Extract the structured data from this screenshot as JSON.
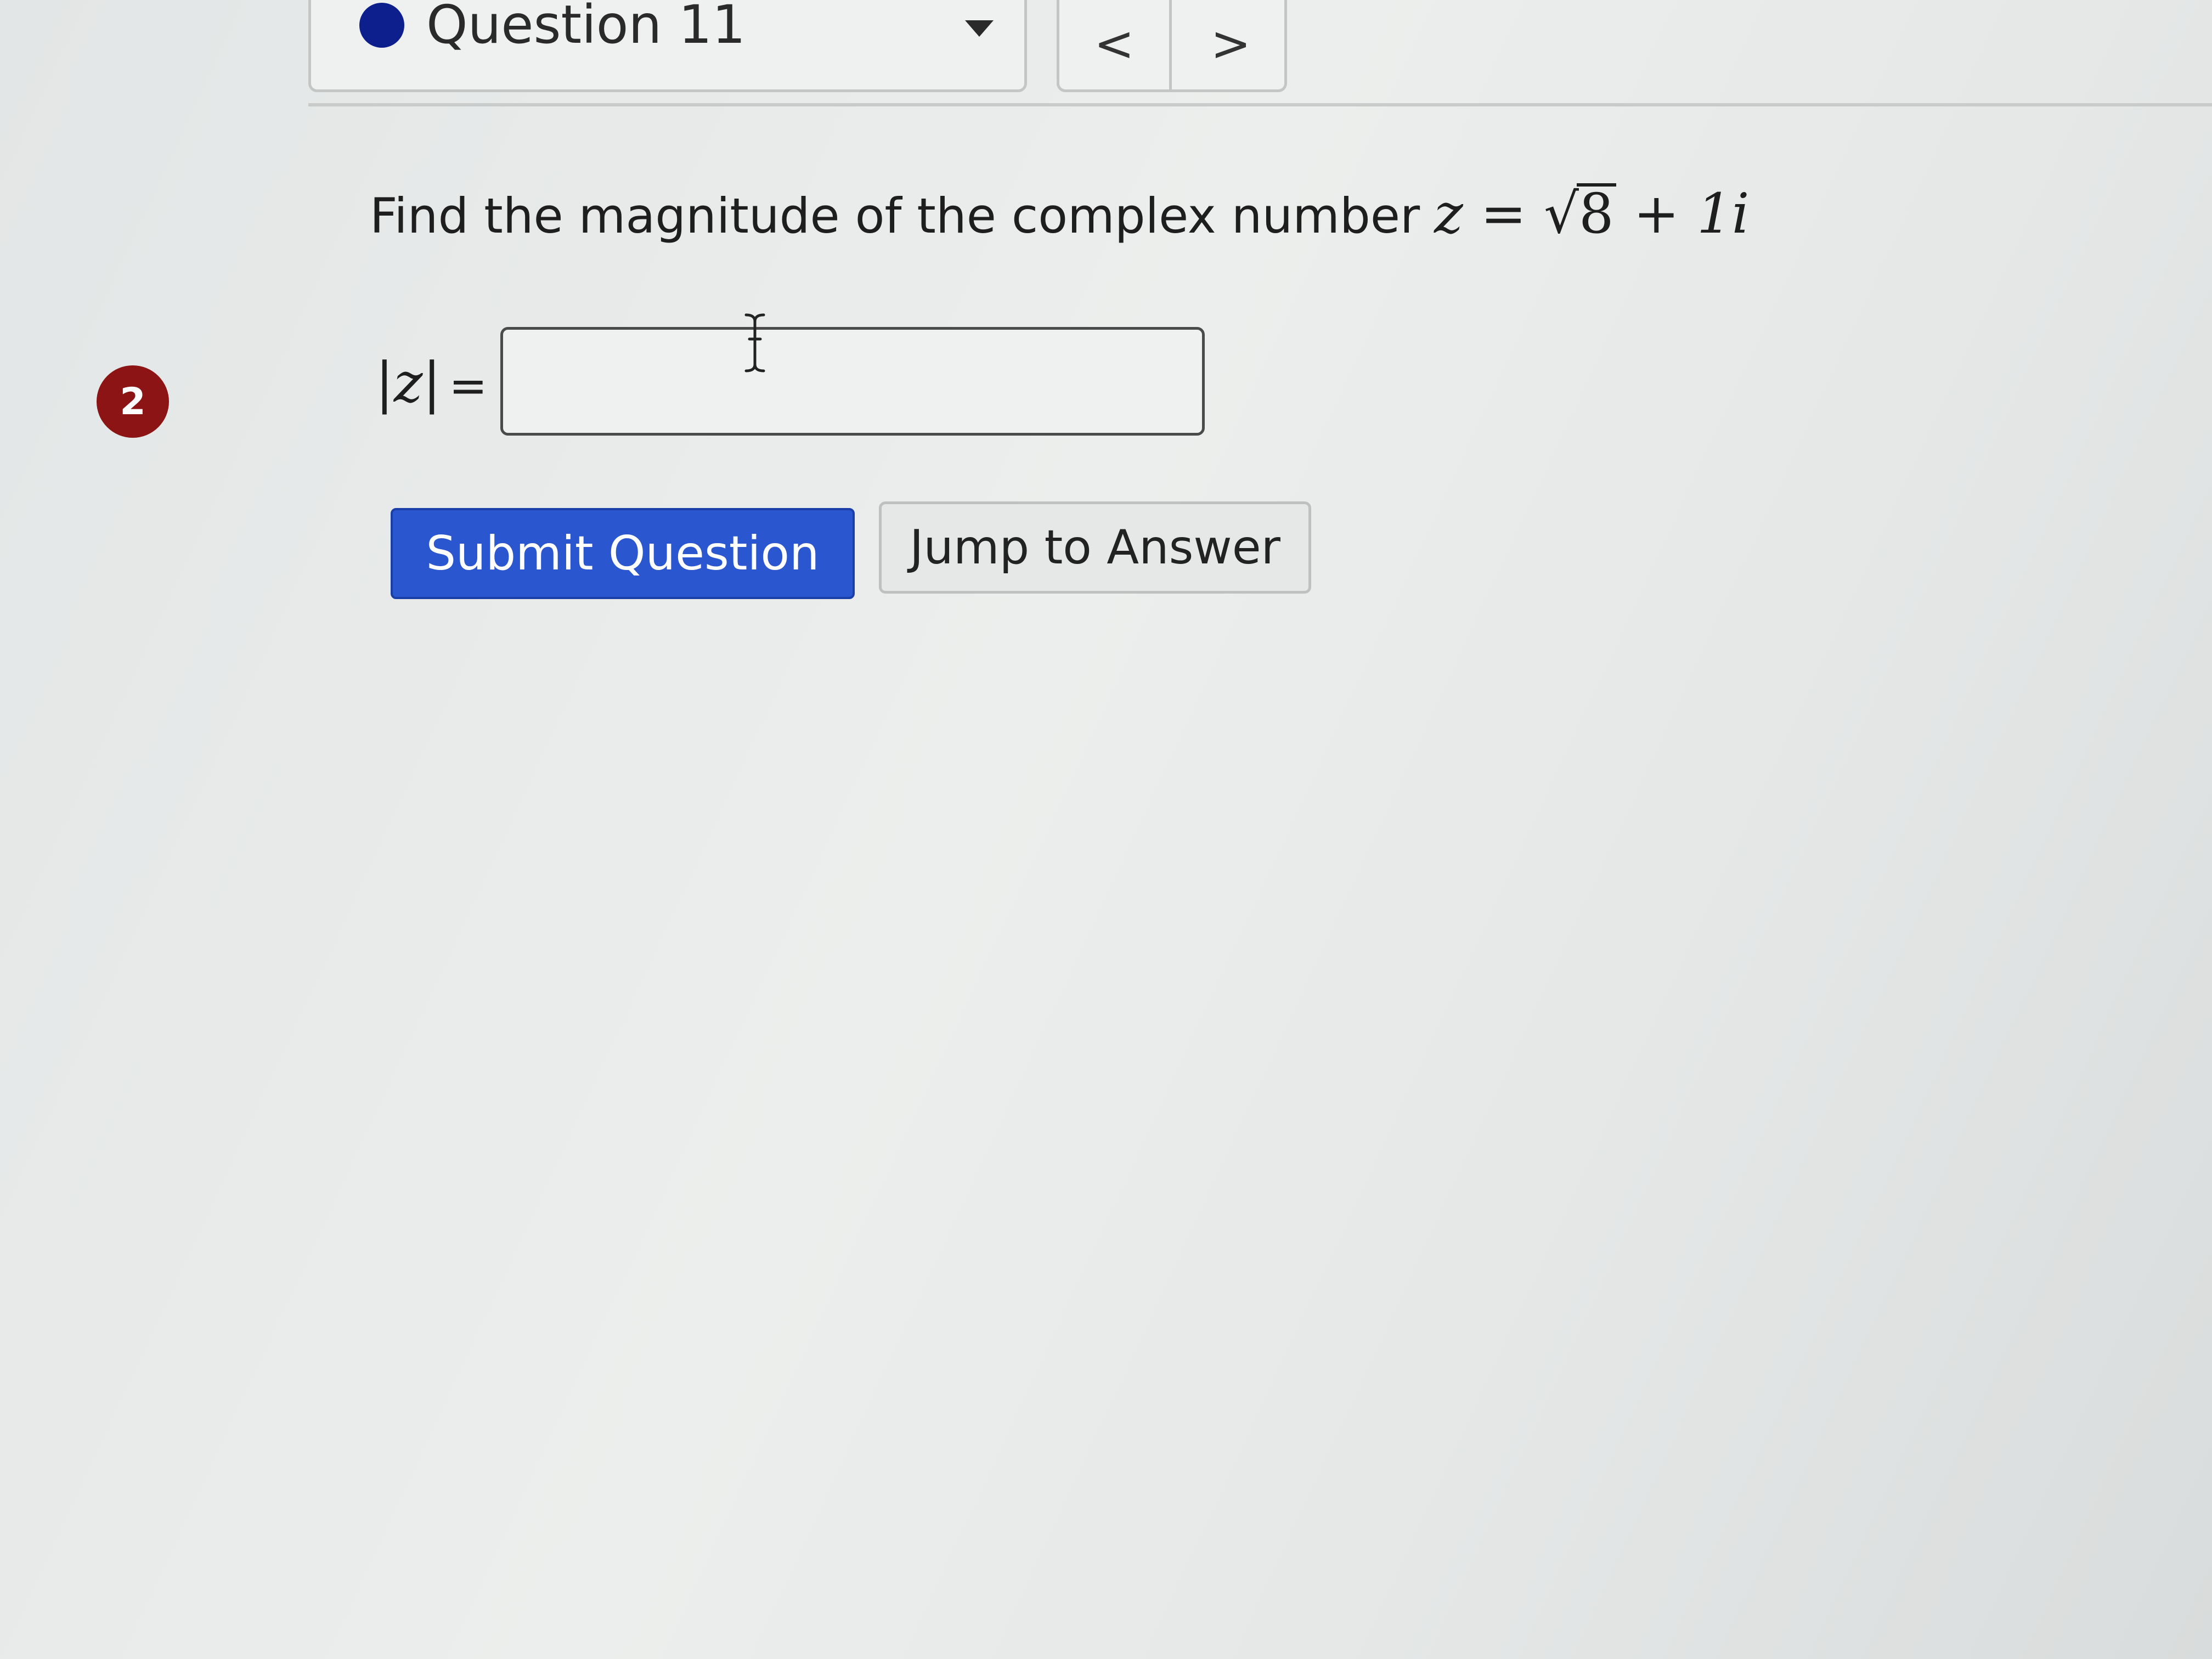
{
  "question_nav": {
    "title": "Question 11",
    "status_color": "#0d1f8c",
    "dropdown_icon": "caret-down-icon",
    "prev_label": "<",
    "next_label": ">"
  },
  "question": {
    "prompt": "Find the magnitude of the complex number",
    "expression": {
      "variable": "z",
      "equals": "=",
      "radicand": "8",
      "plus": "+",
      "imaginary": "1i"
    }
  },
  "answer": {
    "attempts_badge": "2",
    "badge_color": "#8c1414",
    "label": "|z|",
    "equals": "=",
    "value": "",
    "placeholder": ""
  },
  "actions": {
    "submit_label": "Submit Question",
    "submit_color": "#2a56cf",
    "jump_label": "Jump to Answer"
  }
}
